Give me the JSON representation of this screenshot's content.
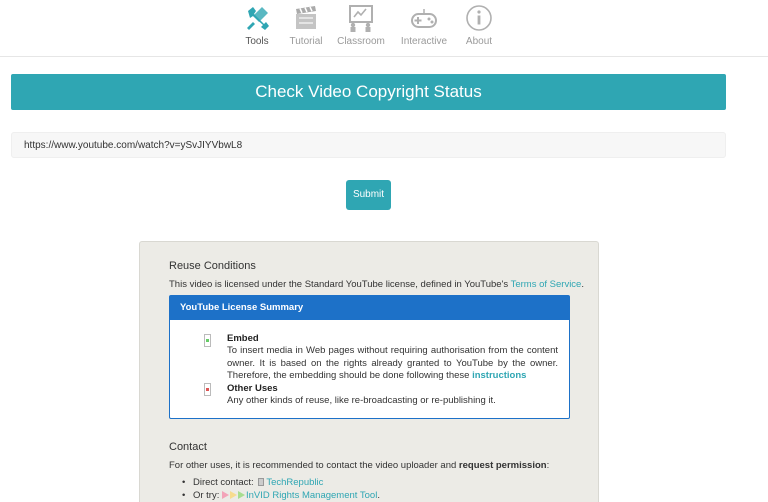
{
  "nav": {
    "items": [
      {
        "label": "Tools",
        "icon": "tools-icon",
        "active": true
      },
      {
        "label": "Tutorial",
        "icon": "film-icon",
        "active": false
      },
      {
        "label": "Classroom",
        "icon": "classroom-icon",
        "active": false
      },
      {
        "label": "Interactive",
        "icon": "gamepad-icon",
        "active": false
      },
      {
        "label": "About",
        "icon": "info-icon",
        "active": false
      }
    ]
  },
  "banner": {
    "title": "Check Video Copyright Status"
  },
  "form": {
    "url_value": "https://www.youtube.com/watch?v=ySvJIYVbwL8",
    "submit_label": "Submit"
  },
  "reuse": {
    "heading": "Reuse Conditions",
    "intro_prefix": "This video is licensed under the Standard YouTube license, defined in YouTube's ",
    "intro_link": "Terms of Service",
    "intro_suffix": ".",
    "summary_title": "YouTube License Summary",
    "embed_title": "Embed",
    "embed_text": "To insert media in Web pages without requiring authorisation from the content owner. It is based on the rights already granted to YouTube by the owner. Therefore, the embedding should be done following these ",
    "embed_link": "instructions",
    "other_title": "Other Uses",
    "other_text": "Any other kinds of reuse, like re-broadcasting or re-publishing it."
  },
  "contact": {
    "heading": "Contact",
    "intro_prefix": "For other uses, it is recommended to contact the video uploader and ",
    "intro_strong": "request permission",
    "intro_suffix": ":",
    "direct_label": "Direct contact: ",
    "direct_link": "TechRepublic",
    "try_label": "Or try: ",
    "try_link": "InVID Rights Management Tool",
    "try_suffix": "."
  },
  "colors": {
    "accent": "#2fa6b3",
    "summary_blue": "#1d71c8",
    "panel_bg": "#ecebe6"
  }
}
